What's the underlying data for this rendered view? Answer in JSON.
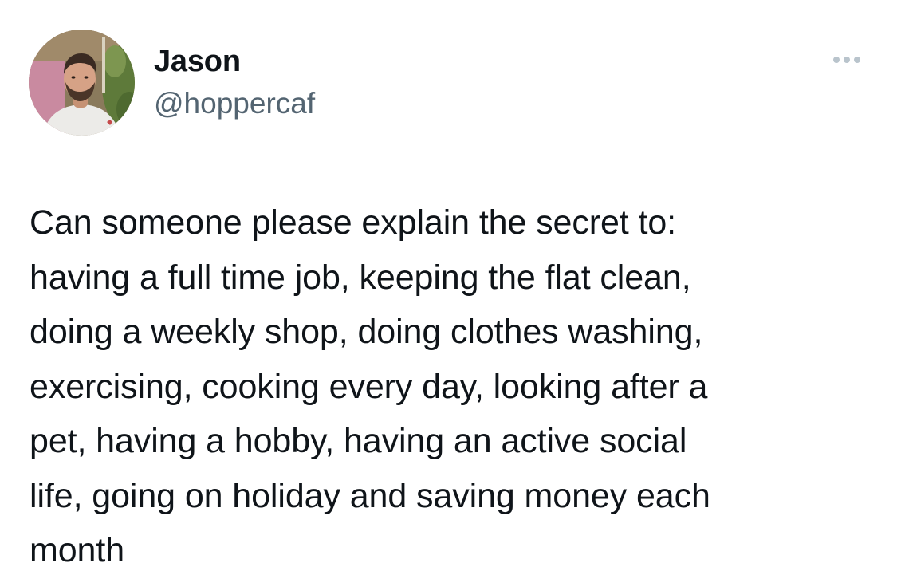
{
  "tweet": {
    "author": {
      "display_name": "Jason",
      "handle": "@hoppercaf"
    },
    "more_icon": "more-horizontal-icon",
    "text_lines": [
      "Can someone please explain the secret to:",
      "having a full time job, keeping the flat clean,",
      "doing a weekly shop, doing clothes washing,",
      "exercising, cooking every day, looking after a",
      "pet, having a hobby, having an active social",
      "life, going on holiday and saving money each",
      "month"
    ]
  },
  "colors": {
    "text": "#0f1419",
    "secondary_text": "#536471",
    "icon_muted": "#b9c4cc",
    "background": "#ffffff"
  }
}
